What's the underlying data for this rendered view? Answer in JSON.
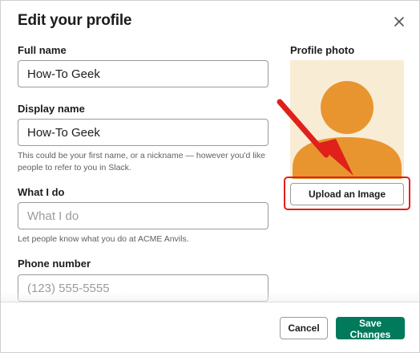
{
  "dialog": {
    "title": "Edit your profile",
    "close_icon": "close-icon"
  },
  "fields": {
    "full_name": {
      "label": "Full name",
      "value": "How-To Geek"
    },
    "display_name": {
      "label": "Display name",
      "value": "How-To Geek",
      "hint": "This could be your first name, or a nickname — however you'd like people to refer to you in Slack."
    },
    "what_i_do": {
      "label": "What I do",
      "value": "",
      "placeholder": "What I do",
      "hint": "Let people know what you do at ACME Anvils."
    },
    "phone": {
      "label": "Phone number",
      "value": "",
      "placeholder": "(123) 555-5555"
    }
  },
  "photo": {
    "label": "Profile photo",
    "upload_label": "Upload an Image",
    "avatar_color": "#e8952f",
    "avatar_bg": "#f8ecd5"
  },
  "annotation": {
    "highlight_color": "#e0201b"
  },
  "footer": {
    "cancel_label": "Cancel",
    "save_label": "Save Changes",
    "save_color": "#007a5a"
  }
}
